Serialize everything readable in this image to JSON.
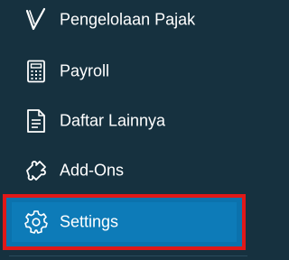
{
  "menu": {
    "items": [
      {
        "label": "Pengelolaan Pajak",
        "icon": "checkmark-icon"
      },
      {
        "label": "Payroll",
        "icon": "calculator-icon"
      },
      {
        "label": "Daftar Lainnya",
        "icon": "document-list-icon"
      },
      {
        "label": "Add-Ons",
        "icon": "puzzle-icon"
      },
      {
        "label": "Settings",
        "icon": "gear-icon",
        "active": true
      }
    ]
  },
  "colors": {
    "background": "#16313f",
    "active_background": "#0d7bb8",
    "highlight_border": "#e01818",
    "text": "#ffffff"
  }
}
